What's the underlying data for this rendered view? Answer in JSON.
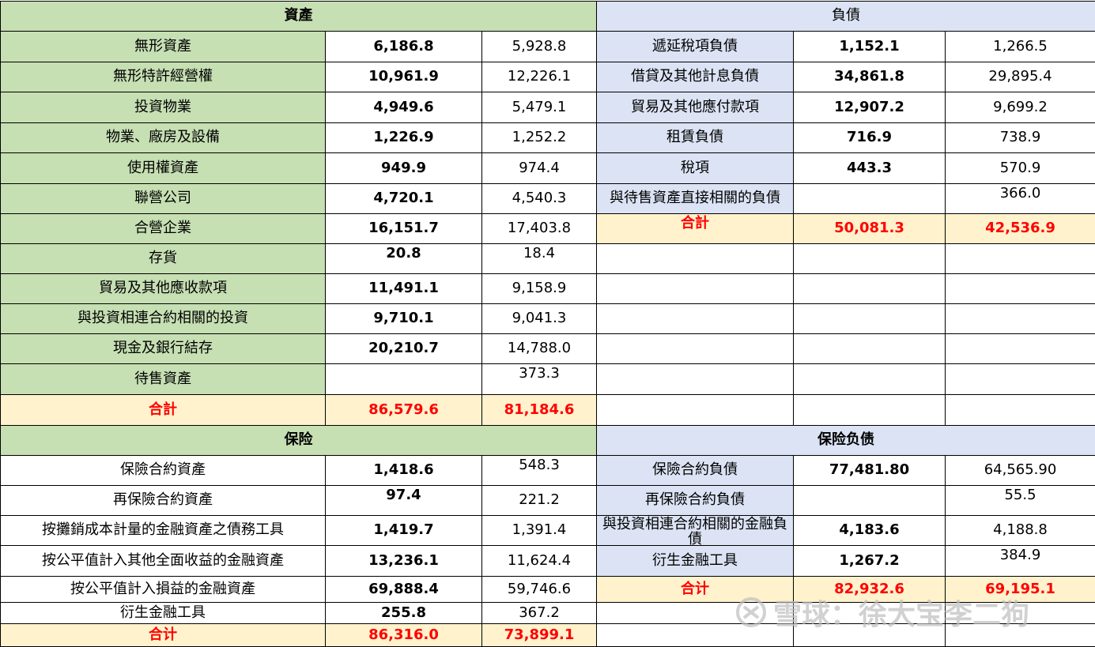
{
  "assets": {
    "header": "資產",
    "rows": [
      {
        "label": "無形資產",
        "current": "6,186.8",
        "prior": "5,928.8"
      },
      {
        "label": "無形特許經營權",
        "current": "10,961.9",
        "prior": "12,226.1"
      },
      {
        "label": "投資物業",
        "current": "4,949.6",
        "prior": "5,479.1"
      },
      {
        "label": "物業、廠房及設備",
        "current": "1,226.9",
        "prior": "1,252.2"
      },
      {
        "label": "使用權資產",
        "current": "949.9",
        "prior": "974.4"
      },
      {
        "label": "聯營公司",
        "current": "4,720.1",
        "prior": "4,540.3"
      },
      {
        "label": "合營企業",
        "current": "16,151.7",
        "prior": "17,403.8"
      },
      {
        "label": "存貨",
        "current": "20.8",
        "prior": "18.4"
      },
      {
        "label": "貿易及其他應收款項",
        "current": "11,491.1",
        "prior": "9,158.9"
      },
      {
        "label": "與投資相連合約相關的投資",
        "current": "9,710.1",
        "prior": "9,041.3"
      },
      {
        "label": "現金及銀行結存",
        "current": "20,210.7",
        "prior": "14,788.0"
      },
      {
        "label": "待售資產",
        "current": "",
        "prior": "373.3"
      }
    ],
    "total": {
      "label": "合計",
      "current": "86,579.6",
      "prior": "81,184.6"
    }
  },
  "liabilities": {
    "header": "負債",
    "rows": [
      {
        "label": "遞延稅項負債",
        "current": "1,152.1",
        "prior": "1,266.5"
      },
      {
        "label": "借貸及其他計息負債",
        "current": "34,861.8",
        "prior": "29,895.4"
      },
      {
        "label": "貿易及其他應付款項",
        "current": "12,907.2",
        "prior": "9,699.2"
      },
      {
        "label": "租賃負債",
        "current": "716.9",
        "prior": "738.9"
      },
      {
        "label": "稅項",
        "current": "443.3",
        "prior": "570.9"
      },
      {
        "label": "與待售資產直接相關的負債",
        "current": "",
        "prior": "366.0"
      }
    ],
    "total": {
      "label": "合計",
      "current": "50,081.3",
      "prior": "42,536.9"
    }
  },
  "insurance": {
    "header": "保险",
    "rows": [
      {
        "label": "保險合約資產",
        "current": "1,418.6",
        "prior": "548.3"
      },
      {
        "label": "再保險合約資產",
        "current": "97.4",
        "prior": "221.2"
      },
      {
        "label": "按攤銷成本計量的金融資產之債務工具",
        "current": "1,419.7",
        "prior": "1,391.4"
      },
      {
        "label": "按公平值計入其他全面收益的金融資產",
        "current": "13,236.1",
        "prior": "11,624.4"
      },
      {
        "label": "按公平值計入損益的金融資產",
        "current": "69,888.4",
        "prior": "59,746.6"
      },
      {
        "label": "衍生金融工具",
        "current": "255.8",
        "prior": "367.2"
      }
    ],
    "total": {
      "label": "合计",
      "current": "86,316.0",
      "prior": "73,899.1"
    }
  },
  "insurance_liabilities": {
    "header": "保险负债",
    "rows": [
      {
        "label": "保險合約負債",
        "current": "77,481.80",
        "prior": "64,565.90"
      },
      {
        "label": "再保險合約負債",
        "current": "",
        "prior": "55.5"
      },
      {
        "label": "與投資相連合約相關的金融負債",
        "current": "4,183.6",
        "prior": "4,188.8"
      },
      {
        "label": "衍生金融工具",
        "current": "1,267.2",
        "prior": "384.9"
      }
    ],
    "total": {
      "label": "合计",
      "current": "82,932.6",
      "prior": "69,195.1"
    }
  },
  "watermark": {
    "text": "雪球：徐大宝李二狗",
    "icon": "snowball-logo-icon"
  },
  "colors": {
    "asset_green": "#c6dfb3",
    "liability_blue": "#dbe3f4",
    "total_yellow": "#fff2cc",
    "total_red": "#ff0000"
  }
}
